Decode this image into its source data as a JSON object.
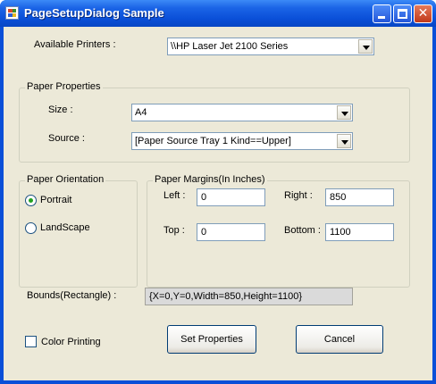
{
  "window": {
    "title": "PageSetupDialog Sample"
  },
  "printers": {
    "label": "Available Printers :",
    "selected": "\\\\HP Laser Jet 2100 Series"
  },
  "paper_properties": {
    "legend": "Paper Properties",
    "size_label": "Size :",
    "size_value": "A4",
    "source_label": "Source :",
    "source_value": "[Paper Source Tray 1 Kind==Upper]"
  },
  "orientation": {
    "legend": "Paper Orientation",
    "portrait_label": "Portrait",
    "landscape_label": "LandScape",
    "selected": "Portrait"
  },
  "margins": {
    "legend": "Paper Margins(In Inches)",
    "left_label": "Left :",
    "left_value": "0",
    "right_label": "Right :",
    "right_value": "850",
    "top_label": "Top :",
    "top_value": "0",
    "bottom_label": "Bottom :",
    "bottom_value": "1100"
  },
  "bounds": {
    "label": "Bounds(Rectangle) :",
    "value": "{X=0,Y=0,Width=850,Height=1100}"
  },
  "color_printing": {
    "label": "Color Printing",
    "checked": false
  },
  "buttons": {
    "set_properties": "Set Properties",
    "cancel": "Cancel"
  }
}
